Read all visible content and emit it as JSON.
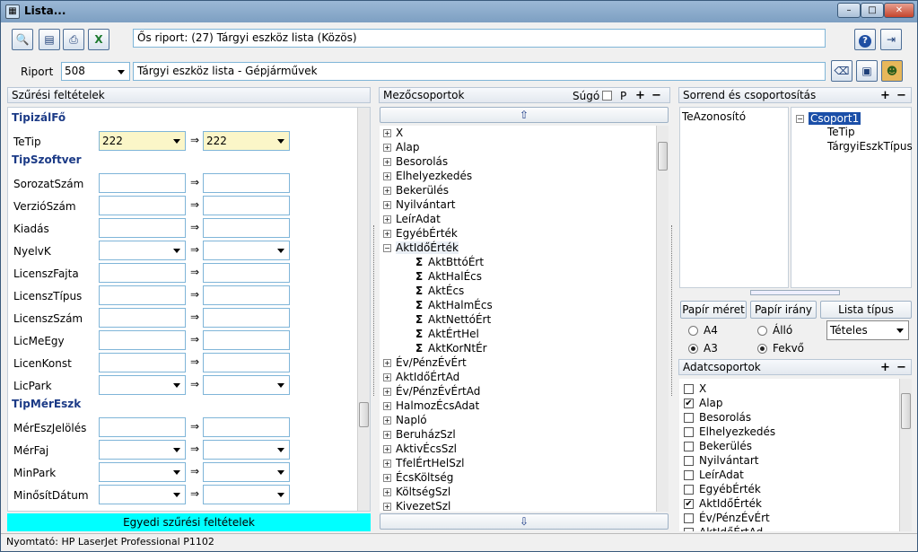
{
  "window": {
    "title": "Lista...",
    "min": "–",
    "max": "□",
    "close": "✕"
  },
  "toolbar": {
    "origin_report": "Ős riport: (27)  Tárgyi eszköz lista (Közös)"
  },
  "report": {
    "label": "Riport",
    "id": "508",
    "name": "Tárgyi eszköz lista - Gépjárművek"
  },
  "filter": {
    "title": "Szűrési feltételek",
    "footer": "Egyedi szűrési feltételek",
    "sections": [
      {
        "name": "TipizálFő",
        "fields": [
          {
            "label": "TeTip",
            "from": "222",
            "to": "222",
            "dd": true,
            "yellow": true
          }
        ]
      },
      {
        "name": "TipSzoftver",
        "fields": [
          {
            "label": "SorozatSzám",
            "from": "",
            "to": "",
            "dd": false
          },
          {
            "label": "VerzióSzám",
            "from": "",
            "to": "",
            "dd": false
          },
          {
            "label": "Kiadás",
            "from": "",
            "to": "",
            "dd": false
          },
          {
            "label": "NyelvK",
            "from": "",
            "to": "",
            "dd": true
          },
          {
            "label": "LicenszFajta",
            "from": "",
            "to": "",
            "dd": false
          },
          {
            "label": "LicenszTípus",
            "from": "",
            "to": "",
            "dd": false
          },
          {
            "label": "LicenszSzám",
            "from": "",
            "to": "",
            "dd": false
          },
          {
            "label": "LicMeEgy",
            "from": "",
            "to": "",
            "dd": false
          },
          {
            "label": "LicenKonst",
            "from": "",
            "to": "",
            "dd": false
          },
          {
            "label": "LicPark",
            "from": "",
            "to": "",
            "dd": true
          }
        ]
      },
      {
        "name": "TipMérEszk",
        "fields": [
          {
            "label": "MérEszJelölés",
            "from": "",
            "to": "",
            "dd": false
          },
          {
            "label": "MérFaj",
            "from": "",
            "to": "",
            "dd": true
          },
          {
            "label": "MinPark",
            "from": "",
            "to": "",
            "dd": true
          },
          {
            "label": "MinősítDátum",
            "from": "",
            "to": "",
            "dd": true
          }
        ]
      }
    ],
    "arrow": "⇒"
  },
  "fields": {
    "title": "Mezőcsoportok",
    "help": "Súgó",
    "p": "P",
    "tree": [
      {
        "t": "X",
        "k": "g"
      },
      {
        "t": "Alap",
        "k": "g"
      },
      {
        "t": "Besorolás",
        "k": "g"
      },
      {
        "t": "Elhelyezkedés",
        "k": "g"
      },
      {
        "t": "Bekerülés",
        "k": "g"
      },
      {
        "t": "Nyilvántart",
        "k": "g"
      },
      {
        "t": "LeírAdat",
        "k": "g"
      },
      {
        "t": "EgyébÉrték",
        "k": "g"
      },
      {
        "t": "AktIdőÉrték",
        "k": "o"
      },
      {
        "t": "AktBttóÉrt",
        "k": "s"
      },
      {
        "t": "AktHalÉcs",
        "k": "s"
      },
      {
        "t": "AktÉcs",
        "k": "s"
      },
      {
        "t": "AktHalmÉcs",
        "k": "s"
      },
      {
        "t": "AktNettóÉrt",
        "k": "s"
      },
      {
        "t": "AktÉrtHel",
        "k": "s"
      },
      {
        "t": "AktKorNtÉr",
        "k": "s"
      },
      {
        "t": "Év/PénzÉvÉrt",
        "k": "g"
      },
      {
        "t": "AktIdőÉrtAd",
        "k": "g"
      },
      {
        "t": "Év/PénzÉvÉrtAd",
        "k": "g"
      },
      {
        "t": "HalmozÉcsAdat",
        "k": "g"
      },
      {
        "t": "Napló",
        "k": "g"
      },
      {
        "t": "BeruházSzl",
        "k": "g"
      },
      {
        "t": "AktivÉcsSzl",
        "k": "g"
      },
      {
        "t": "TfelÉrtHelSzl",
        "k": "g"
      },
      {
        "t": "ÉcsKöltség",
        "k": "g"
      },
      {
        "t": "KöltségSzl",
        "k": "g"
      },
      {
        "t": "KivezetSzl",
        "k": "g"
      }
    ]
  },
  "sort": {
    "title": "Sorrend és csoportosítás",
    "left": "TeAzonosító",
    "group": "Csoport1",
    "children": [
      "TeTip",
      "TárgyiEszkTípus"
    ]
  },
  "paper": {
    "size_btn": "Papír méret",
    "orient_btn": "Papír irány",
    "type_btn": "Lista típus",
    "a4": "A4",
    "a3": "A3",
    "portrait": "Álló",
    "landscape": "Fekvő",
    "list_type": "Tételes"
  },
  "data_groups": {
    "title": "Adatcsoportok",
    "items": [
      {
        "t": "X",
        "c": false
      },
      {
        "t": "Alap",
        "c": true
      },
      {
        "t": "Besorolás",
        "c": false
      },
      {
        "t": "Elhelyezkedés",
        "c": false
      },
      {
        "t": "Bekerülés",
        "c": false
      },
      {
        "t": "Nyilvántart",
        "c": false
      },
      {
        "t": "LeírAdat",
        "c": false
      },
      {
        "t": "EgyébÉrték",
        "c": false
      },
      {
        "t": "AktIdőÉrték",
        "c": true
      },
      {
        "t": "Év/PénzÉvÉrt",
        "c": false
      },
      {
        "t": "AktIdőÉrtAd",
        "c": false
      }
    ]
  },
  "status": "Nyomtató: HP LaserJet Professional P1102"
}
